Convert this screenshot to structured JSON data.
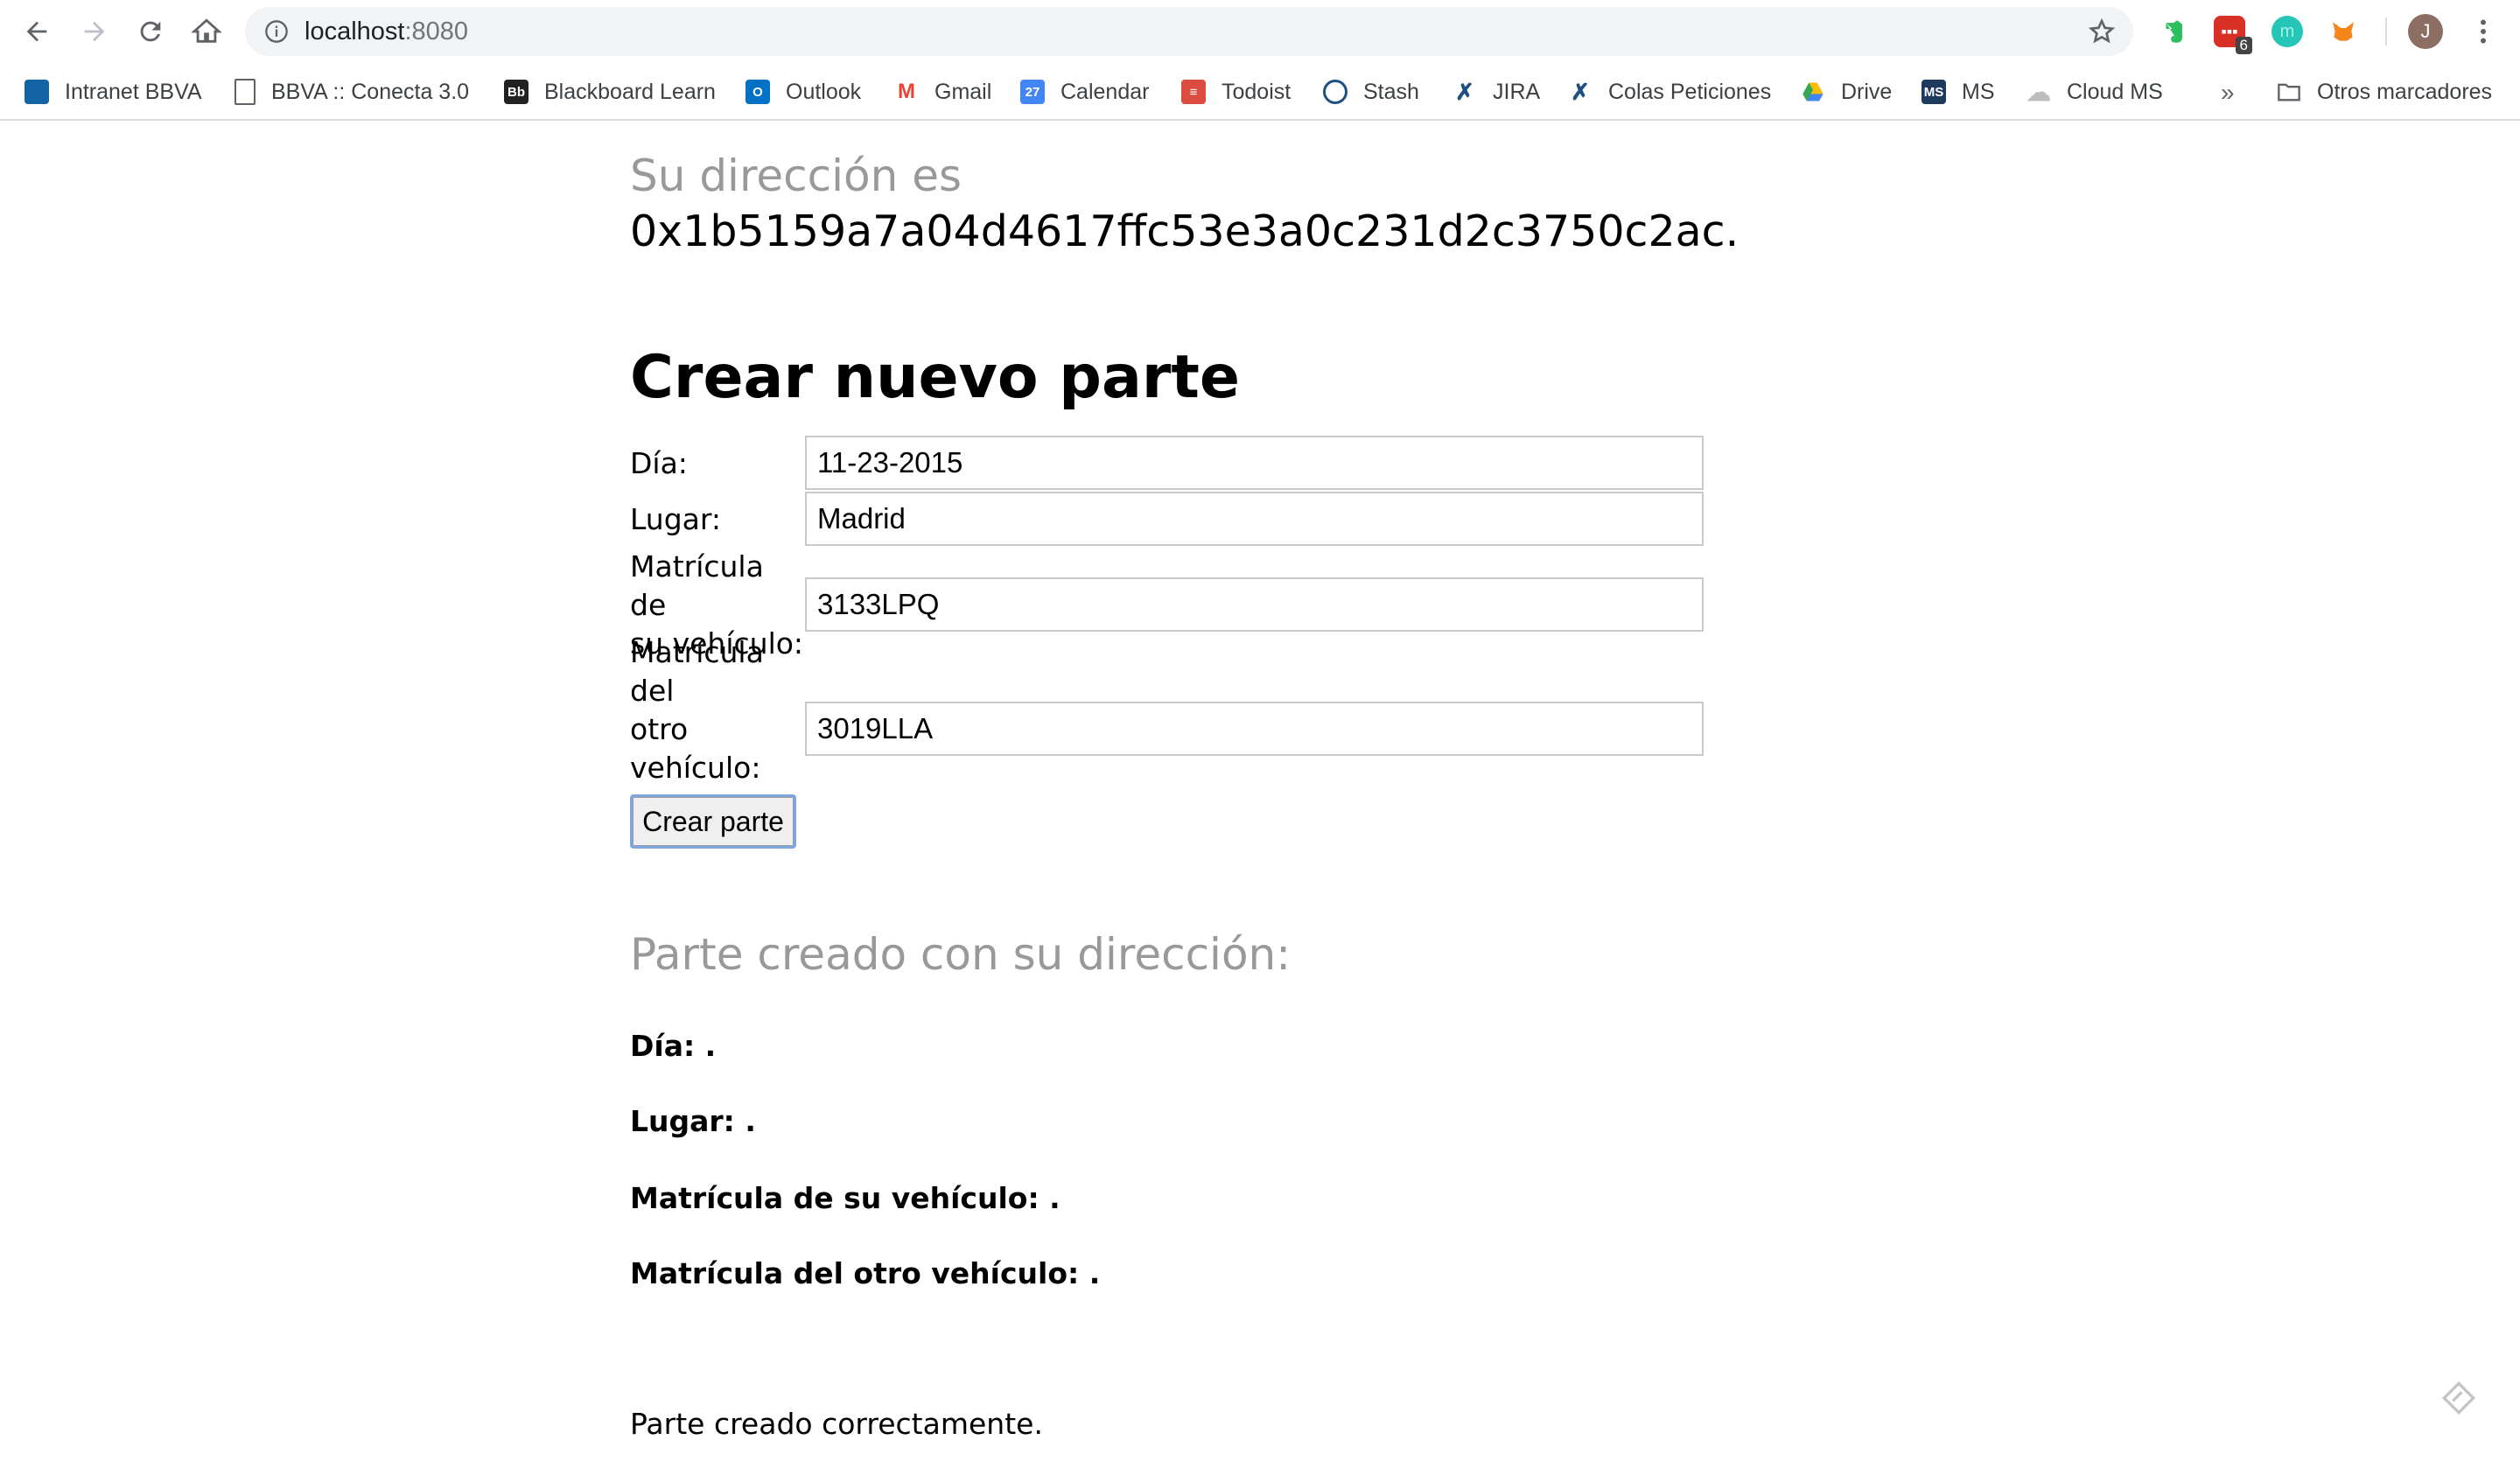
{
  "browser": {
    "url_host": "localhost",
    "url_port": ":8080",
    "extensions": [
      {
        "name": "evernote",
        "color": "#2dbe60"
      },
      {
        "name": "calendar-ext",
        "color": "#d93025",
        "badge": "6"
      },
      {
        "name": "teal-ext",
        "color": "#26c6b7"
      },
      {
        "name": "metamask",
        "color": "#f6851b"
      }
    ],
    "avatar_letter": "J"
  },
  "bookmarks": [
    {
      "label": "Intranet BBVA",
      "icon": "bbva-icon",
      "color": "#1464a5"
    },
    {
      "label": "BBVA :: Conecta 3.0",
      "icon": "page-icon",
      "color": "#ffffff"
    },
    {
      "label": "Blackboard Learn",
      "icon": "blackboard-icon",
      "color": "#222222"
    },
    {
      "label": "Outlook",
      "icon": "outlook-icon",
      "color": "#0072c6"
    },
    {
      "label": "Gmail",
      "icon": "gmail-icon",
      "color": "#ea4335"
    },
    {
      "label": "Calendar",
      "icon": "calendar-icon",
      "color": "#4285f4"
    },
    {
      "label": "Todoist",
      "icon": "todoist-icon",
      "color": "#db4c3f"
    },
    {
      "label": "Stash",
      "icon": "stash-icon",
      "color": "#205081"
    },
    {
      "label": "JIRA",
      "icon": "jira-icon",
      "color": "#205081"
    },
    {
      "label": "Colas Peticiones",
      "icon": "jira-icon",
      "color": "#205081"
    },
    {
      "label": "Drive",
      "icon": "drive-icon",
      "color": "#fbbc04"
    },
    {
      "label": "MS",
      "icon": "ms-icon",
      "color": "#1e3a5f"
    },
    {
      "label": "Cloud MS",
      "icon": "cloud-icon",
      "color": "#bdbdbd"
    }
  ],
  "bookmarks_more": "»",
  "other_bookmarks": "Otros marcadores",
  "page": {
    "address_label": "Su dirección es",
    "address_value": "0x1b5159a7a04d4617ffc53e3a0c231d2c3750c2ac.",
    "form_title": "Crear nuevo parte",
    "fields": {
      "dia_label": "Día:",
      "dia_value": "11-23-2015",
      "lugar_label": "Lugar:",
      "lugar_value": "Madrid",
      "matricula_su_label_1": "Matrícula de",
      "matricula_su_label_2": "su vehículo:",
      "matricula_su_value": "3133LPQ",
      "matricula_otro_label_1": "Matrícula del",
      "matricula_otro_label_2": "otro",
      "matricula_otro_label_3": "vehículo:",
      "matricula_otro_value": "3019LLA"
    },
    "submit_label": "Crear parte",
    "result_title": "Parte creado con su dirección:",
    "result": {
      "dia": "Día: .",
      "lugar": "Lugar: .",
      "matricula_su": "Matrícula de su vehículo: .",
      "matricula_otro": "Matrícula del otro vehículo: ."
    },
    "status": "Parte creado correctamente."
  }
}
